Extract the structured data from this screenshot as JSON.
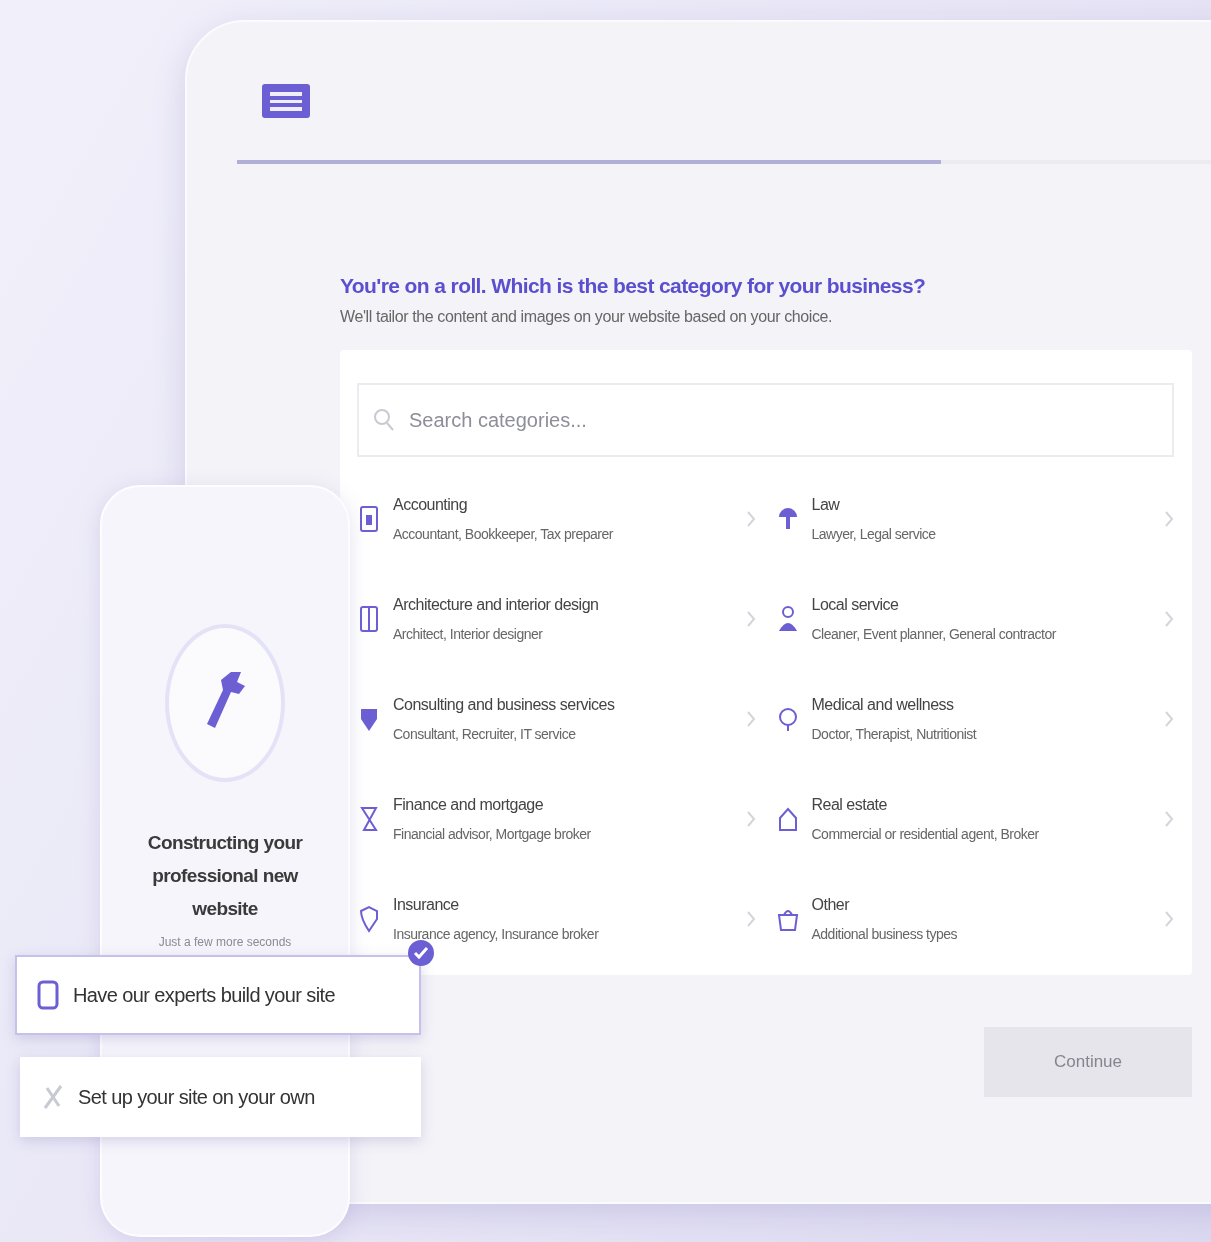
{
  "header": {
    "progress": {
      "level": 0.67
    }
  },
  "question": {
    "title": "You're on a roll. Which is the best category for your business?",
    "subtitle": "We'll tailor the content and images on your website based on your choice."
  },
  "search": {
    "placeholder": "Search categories..."
  },
  "categories": [
    {
      "title": "Accounting",
      "examples": "Accountant, Bookkeeper, Tax preparer"
    },
    {
      "title": "Law",
      "examples": "Lawyer, Legal service"
    },
    {
      "title": "Architecture and interior design",
      "examples": "Architect, Interior designer"
    },
    {
      "title": "Local service",
      "examples": "Cleaner, Event planner, General contractor"
    },
    {
      "title": "Consulting and business services",
      "examples": "Consultant, Recruiter, IT service"
    },
    {
      "title": "Medical and wellness",
      "examples": "Doctor, Therapist, Nutritionist"
    },
    {
      "title": "Finance and mortgage",
      "examples": "Financial advisor, Mortgage broker"
    },
    {
      "title": "Real estate",
      "examples": "Commercial or residential agent, Broker"
    },
    {
      "title": "Insurance",
      "examples": "Insurance agency, Insurance broker"
    },
    {
      "title": "Other",
      "examples": "Additional business types"
    }
  ],
  "footer": {
    "continue": {
      "label": "Continue",
      "disabled": true
    }
  },
  "phone": {
    "title": "Constructing your professional new website",
    "subtitle": "Just a few more seconds"
  },
  "options": [
    {
      "label": "Have our experts build your site",
      "selected": true
    },
    {
      "label": "Set up your site on your own",
      "selected": false
    }
  ]
}
